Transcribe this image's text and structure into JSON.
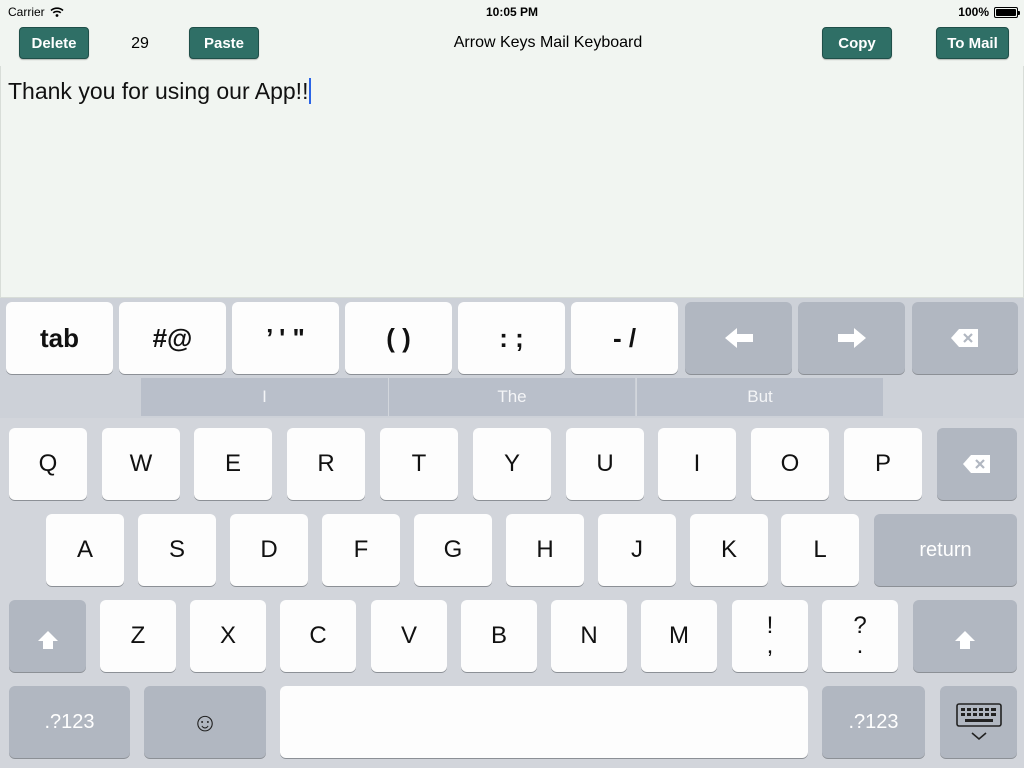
{
  "status_bar": {
    "carrier": "Carrier",
    "time": "10:05 PM",
    "battery": "100%"
  },
  "toolbar": {
    "delete_label": "Delete",
    "count": "29",
    "paste_label": "Paste",
    "title": "Arrow Keys Mail Keyboard",
    "copy_label": "Copy",
    "to_mail_label": "To Mail",
    "button_color": "#2f6f66"
  },
  "editor": {
    "text": "Thank you for using our App!!"
  },
  "keyboard": {
    "accessory_keys": [
      "tab",
      "#@",
      "’ ' \"",
      "( )",
      ": ;",
      "- /"
    ],
    "suggestions": [
      "I",
      "The",
      "But"
    ],
    "row1": [
      "Q",
      "W",
      "E",
      "R",
      "T",
      "Y",
      "U",
      "I",
      "O",
      "P"
    ],
    "row2": [
      "A",
      "S",
      "D",
      "F",
      "G",
      "H",
      "J",
      "K",
      "L"
    ],
    "row3": [
      "Z",
      "X",
      "C",
      "V",
      "B",
      "N",
      "M"
    ],
    "punct1_top": "!",
    "punct1_bottom": ",",
    "punct2_top": "?",
    "punct2_bottom": ".",
    "return_label": "return",
    "numbers_label": ".?123",
    "emoji_symbol": "☺",
    "left_arrow": "⬅",
    "right_arrow": "➡"
  }
}
